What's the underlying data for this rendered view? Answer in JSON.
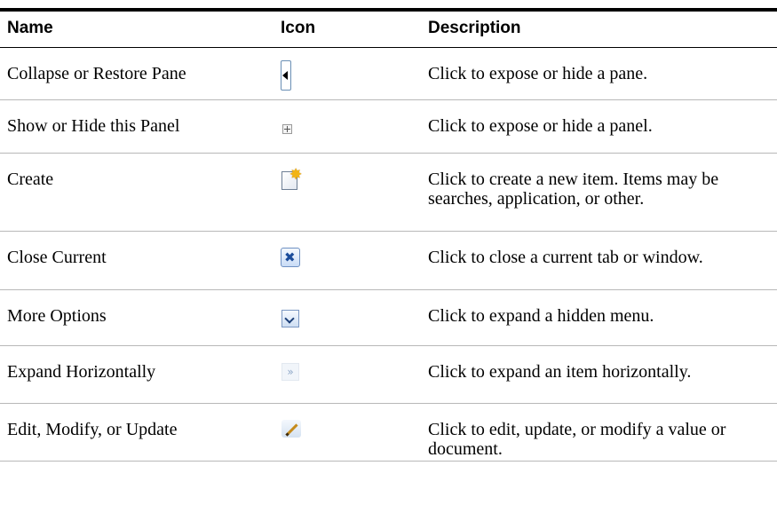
{
  "headers": {
    "name": "Name",
    "icon": "Icon",
    "description": "Description"
  },
  "rows": [
    {
      "name": "Collapse or Restore Pane",
      "icon": "collapse-pane-icon",
      "description": "Click to expose or hide a pane."
    },
    {
      "name": "Show or Hide this Panel",
      "icon": "plus-box-icon",
      "description": "Click to expose or hide a panel."
    },
    {
      "name": "Create",
      "icon": "create-new-icon",
      "description": "Click to create a new item. Items may be searches, application, or other."
    },
    {
      "name": "Close Current",
      "icon": "close-x-icon",
      "description": "Click to close a current tab or window."
    },
    {
      "name": "More Options",
      "icon": "chevron-down-icon",
      "description": "Click to expand a hidden menu."
    },
    {
      "name": "Expand Horizontally",
      "icon": "double-chevron-right-icon",
      "description": "Click to expand an item horizontally."
    },
    {
      "name": "Edit, Modify, or Update",
      "icon": "pencil-icon",
      "description": "Click to edit, update, or modify a value or document."
    }
  ],
  "colors": {
    "header_rule": "#000000",
    "row_rule": "#b8b8b8",
    "icon_blue": "#1b4c9b"
  }
}
